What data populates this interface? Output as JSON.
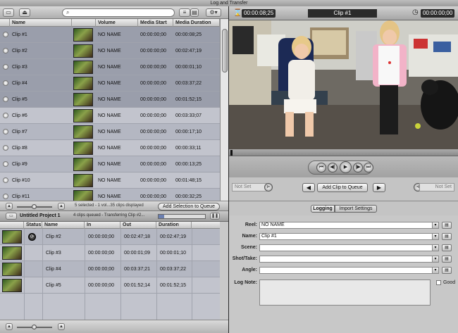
{
  "window": {
    "title": "Log and Transfer"
  },
  "browser": {
    "columns": [
      "Name",
      "Volume",
      "Media Start",
      "Media Duration"
    ],
    "clips": [
      {
        "name": "Clip #1",
        "volume": "NO NAME",
        "start": "00:00:00;00",
        "duration": "00:00:08;25",
        "selected": true
      },
      {
        "name": "Clip #2",
        "volume": "NO NAME",
        "start": "00:00:00;00",
        "duration": "00:02:47;19",
        "selected": true
      },
      {
        "name": "Clip #3",
        "volume": "NO NAME",
        "start": "00:00:00;00",
        "duration": "00:00:01;10",
        "selected": true
      },
      {
        "name": "Clip #4",
        "volume": "NO NAME",
        "start": "00:00:00;00",
        "duration": "00:03:37;22",
        "selected": true
      },
      {
        "name": "Clip #5",
        "volume": "NO NAME",
        "start": "00:00:00;00",
        "duration": "00:01:52;15",
        "selected": true
      },
      {
        "name": "Clip #6",
        "volume": "NO NAME",
        "start": "00:00:00;00",
        "duration": "00:03:33;07",
        "selected": false
      },
      {
        "name": "Clip #7",
        "volume": "NO NAME",
        "start": "00:00:00;00",
        "duration": "00:00:17;10",
        "selected": false
      },
      {
        "name": "Clip #8",
        "volume": "NO NAME",
        "start": "00:00:00;00",
        "duration": "00:00:33;11",
        "selected": false
      },
      {
        "name": "Clip #9",
        "volume": "NO NAME",
        "start": "00:00:00;00",
        "duration": "00:00:13;25",
        "selected": false
      },
      {
        "name": "Clip #10",
        "volume": "NO NAME",
        "start": "00:00:00;00",
        "duration": "00:01:48;15",
        "selected": false
      },
      {
        "name": "Clip #11",
        "volume": "NO NAME",
        "start": "00:00:00;00",
        "duration": "00:00:32;25",
        "selected": false
      }
    ],
    "status_text": "5 selected - 1 vol...35 clips displayed",
    "add_selection_label": "Add Selection to Queue"
  },
  "queue": {
    "project_name": "Untitled Project 1",
    "status_text": "4 clips queued - Transferring Clip #2...",
    "columns": [
      "Status",
      "Name",
      "In",
      "Out",
      "Duration"
    ],
    "items": [
      {
        "name": "Clip #2",
        "in": "00:00:00;00",
        "out": "00:02:47;18",
        "duration": "00:02:47;19",
        "active": true
      },
      {
        "name": "Clip #3",
        "in": "00:00:00;00",
        "out": "00:00:01;09",
        "duration": "00:00:01;10",
        "active": false
      },
      {
        "name": "Clip #4",
        "in": "00:00:00;00",
        "out": "00:03:37;21",
        "duration": "00:03:37;22",
        "active": false
      },
      {
        "name": "Clip #5",
        "in": "00:00:00;00",
        "out": "00:01:52;14",
        "duration": "00:01:52;15",
        "active": false
      }
    ]
  },
  "viewer": {
    "duration_tc": "00:00:08;25",
    "clip_name": "Clip #1",
    "current_tc": "00:00:00;00",
    "in_not_set": "Not Set",
    "out_not_set": "Not Set",
    "add_clip_label": "Add Clip to Queue"
  },
  "logging": {
    "tabs": [
      "Logging",
      "Import Settings"
    ],
    "reel_label": "Reel:",
    "reel_value": "NO NAME",
    "name_label": "Name:",
    "name_value": "Clip #1",
    "scene_label": "Scene:",
    "shot_label": "Shot/Take:",
    "angle_label": "Angle:",
    "log_note_label": "Log Note:",
    "good_label": "Good"
  }
}
